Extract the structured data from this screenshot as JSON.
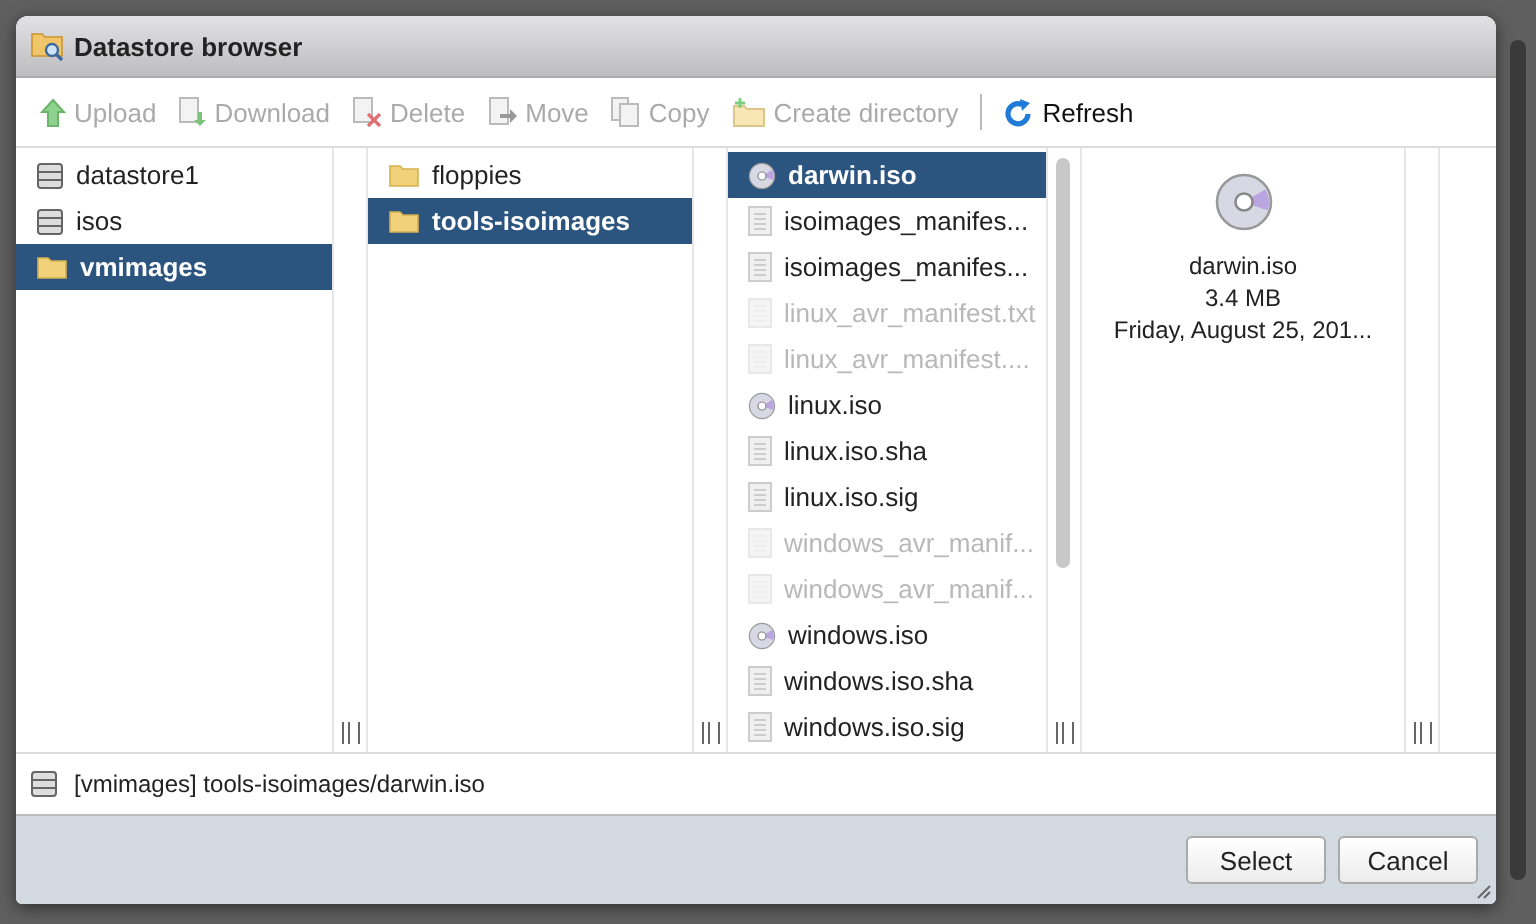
{
  "window": {
    "title": "Datastore browser"
  },
  "toolbar": [
    {
      "label": "Upload",
      "kind": "upload",
      "disabled": true
    },
    {
      "label": "Download",
      "kind": "download",
      "disabled": true
    },
    {
      "label": "Delete",
      "kind": "delete",
      "disabled": true
    },
    {
      "label": "Move",
      "kind": "move",
      "disabled": true
    },
    {
      "label": "Copy",
      "kind": "copy",
      "disabled": true
    },
    {
      "label": "Create directory",
      "kind": "mkdir",
      "disabled": true
    },
    {
      "label": "Refresh",
      "kind": "refresh",
      "disabled": false
    }
  ],
  "datastores": [
    {
      "name": "datastore1",
      "kind": "datastore",
      "selected": false
    },
    {
      "name": "isos",
      "kind": "datastore",
      "selected": false
    },
    {
      "name": "vmimages",
      "kind": "folder",
      "selected": true
    }
  ],
  "folders": [
    {
      "name": "floppies",
      "kind": "folder",
      "selected": false
    },
    {
      "name": "tools-isoimages",
      "kind": "folder",
      "selected": true
    }
  ],
  "files": [
    {
      "name": "darwin.iso",
      "kind": "iso",
      "selected": true,
      "disabled": false
    },
    {
      "name": "isoimages_manifes...",
      "kind": "file",
      "selected": false,
      "disabled": false
    },
    {
      "name": "isoimages_manifes...",
      "kind": "file",
      "selected": false,
      "disabled": false
    },
    {
      "name": "linux_avr_manifest.txt",
      "kind": "file",
      "selected": false,
      "disabled": true
    },
    {
      "name": "linux_avr_manifest....",
      "kind": "file",
      "selected": false,
      "disabled": true
    },
    {
      "name": "linux.iso",
      "kind": "iso",
      "selected": false,
      "disabled": false
    },
    {
      "name": "linux.iso.sha",
      "kind": "file",
      "selected": false,
      "disabled": false
    },
    {
      "name": "linux.iso.sig",
      "kind": "file",
      "selected": false,
      "disabled": false
    },
    {
      "name": "windows_avr_manif...",
      "kind": "file",
      "selected": false,
      "disabled": true
    },
    {
      "name": "windows_avr_manif...",
      "kind": "file",
      "selected": false,
      "disabled": true
    },
    {
      "name": "windows.iso",
      "kind": "iso",
      "selected": false,
      "disabled": false
    },
    {
      "name": "windows.iso.sha",
      "kind": "file",
      "selected": false,
      "disabled": false
    },
    {
      "name": "windows.iso.sig",
      "kind": "file",
      "selected": false,
      "disabled": false
    }
  ],
  "preview": {
    "name": "darwin.iso",
    "size": "3.4 MB",
    "date": "Friday, August 25, 201..."
  },
  "path": "[vmimages] tools-isoimages/darwin.iso",
  "buttons": [
    "Select",
    "Cancel"
  ]
}
